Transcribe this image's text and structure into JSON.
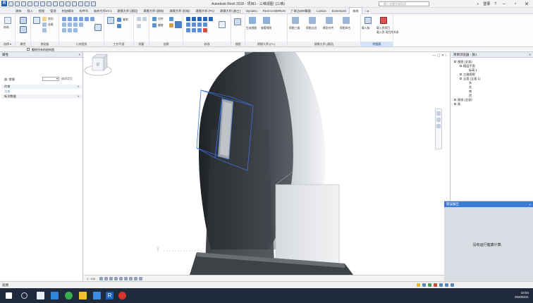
{
  "window": {
    "title": "Autodesk Revit 2018 - 项目1 - 三维视图: {三维}",
    "search_placeholder": "键入关键字或短语",
    "user": "登录"
  },
  "ribbon_tabs": [
    "建筑",
    "插入",
    "视图",
    "管理",
    "附加模块",
    "构件坞",
    "族库大师V3.1",
    "建模大师 (通用)",
    "建模大师 (建筑)",
    "建模大师 (机电)",
    "建模大师 (PC)",
    "建模大师 (施工)",
    "Dynamo",
    "Revit to BIMRUN",
    "广联达BIM算量",
    "Lumion",
    "Extensions",
    "修改",
    "□ ▸"
  ],
  "active_tab": "修改",
  "ribbon_panels": [
    {
      "label": "选择 ▾"
    },
    {
      "label": "属性"
    },
    {
      "label": "剪贴板"
    },
    {
      "label": "几何图形"
    },
    {
      "label": "工作平面"
    },
    {
      "label": "测量"
    },
    {
      "label": "创建"
    },
    {
      "label": "修改"
    },
    {
      "label": "视图"
    },
    {
      "label": "建模大师 (PC)"
    },
    {
      "label": "建模大师 (通用)"
    },
    {
      "label": "明细表"
    }
  ],
  "ribbon_labels": {
    "modify": "修改",
    "join": "连接",
    "cut": "剪切",
    "align": "对齐",
    "offset": "偏移",
    "mirror": "镜像",
    "move": "移动",
    "copy": "复制",
    "rotate": "旋转",
    "trim": "修剪",
    "split": "拆分",
    "array": "阵列",
    "scale": "缩放",
    "pin": "锁定",
    "delete": "删除",
    "create_group": "生成视图",
    "create_detail": "查看视图",
    "view_3d": "视图三维",
    "view_filter": "视图过滤",
    "load_family": "模型对齐",
    "view_rename": "视图命名",
    "import_family": "载入族",
    "export_family": "载入到项目",
    "close_family": "载入到 项目并关闭"
  },
  "options_bar": {
    "label": "翻转所有的结构图"
  },
  "properties": {
    "title": "属性",
    "close": "×",
    "type_label": "族: 常规",
    "type_dropdown": "▾",
    "edit_type": "编辑类型",
    "rows": [
      {
        "label": "约束",
        "value": "»"
      },
      {
        "label": "主体",
        "value": ""
      },
      {
        "label": "标识数据",
        "value": "»"
      }
    ]
  },
  "viewport": {
    "controls": "— ▢ ✕ ↓"
  },
  "view_bar": {
    "scale": "1 : 100"
  },
  "project_browser": {
    "title": "项目浏览器 - 族1",
    "close": "×",
    "items": [
      {
        "label": "视图 (全部)",
        "level": 0
      },
      {
        "label": "楼层平面",
        "level": 1
      },
      {
        "label": "标高 1",
        "level": 2
      },
      {
        "label": "三维视图",
        "level": 1
      },
      {
        "label": "立面 (立面 1)",
        "level": 1
      },
      {
        "label": "东",
        "level": 2
      },
      {
        "label": "北",
        "level": 2
      },
      {
        "label": "南",
        "level": 2
      },
      {
        "label": "西",
        "level": 2
      },
      {
        "label": "图纸 (全部)",
        "level": 0
      },
      {
        "label": "族",
        "level": 0
      }
    ]
  },
  "message_panel": {
    "title": "错误报告",
    "close": "×",
    "text": "没有运行健康计算。"
  },
  "status_bar": {
    "text": "就绪"
  },
  "taskbar": {
    "time": "10:54",
    "date": "2020/6/21"
  },
  "colors": {
    "accent": "#3a7bd5",
    "model_shadow": "#2c2f34",
    "model_light": "#e9ebee",
    "taskbar": "#1f2b3c"
  }
}
